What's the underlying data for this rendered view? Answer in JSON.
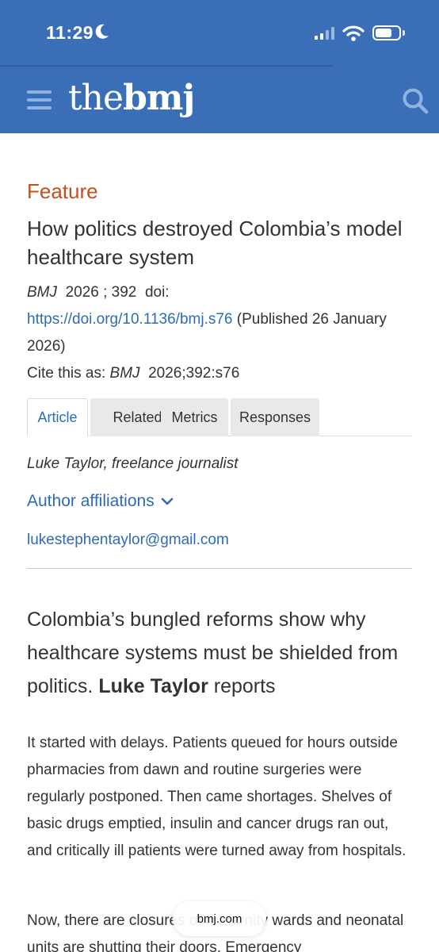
{
  "status_bar": {
    "time": "11:29",
    "moon_icon": "moon-icon",
    "signal_icon": "cellular-signal-icon",
    "wifi_icon": "wifi-icon",
    "battery_icon": "battery-icon",
    "battery_level": 0.7
  },
  "header": {
    "logo_the": "the",
    "logo_bmj": "bmj",
    "menu_icon": "hamburger-menu-icon",
    "search_icon": "search-icon",
    "brand_color": "#3a6fb7"
  },
  "article": {
    "section": "Feature",
    "title": "How politics destroyed Colombia’s model healthcare system",
    "journal": "BMJ",
    "year_volume": "2026 ; 392",
    "doi_label": "doi:",
    "doi_link": "https://doi.org/10.1136/bmj.s76",
    "published": "(Published 26 January 2026)",
    "cite_label": "Cite this as:",
    "cite_journal": "BMJ",
    "cite_ref": "2026;392:s76"
  },
  "tabs": [
    {
      "label": "Article",
      "active": true
    },
    {
      "label": "Related",
      "active": false
    },
    {
      "label": "Metrics",
      "active": false
    },
    {
      "label": "Responses",
      "active": false
    }
  ],
  "author": {
    "byline": "Luke Taylor, freelance journalist",
    "affiliations_label": "Author affiliations",
    "email": "lukestephentaylor@gmail.com"
  },
  "standfirst": {
    "part1": "Colombia’s bungled reforms show why healthcare systems must be shielded from politics.",
    "bold": "Luke Taylor",
    "part2": "reports"
  },
  "body": {
    "p1": "It started with delays. Patients queued for hours outside pharmacies from dawn and routine surgeries were regularly postponed. Then came shortages. Shelves of basic drugs emptied, insulin and cancer drugs ran out, and critically ill patients were turned away from hospitals.",
    "p2": "Now, there are closures of maternity wards and neonatal units are shutting their doors. Emergency"
  },
  "browser": {
    "url": "bmj.com"
  },
  "colors": {
    "accent_orange": "#c0521f",
    "link_blue": "#2d6bb5"
  }
}
